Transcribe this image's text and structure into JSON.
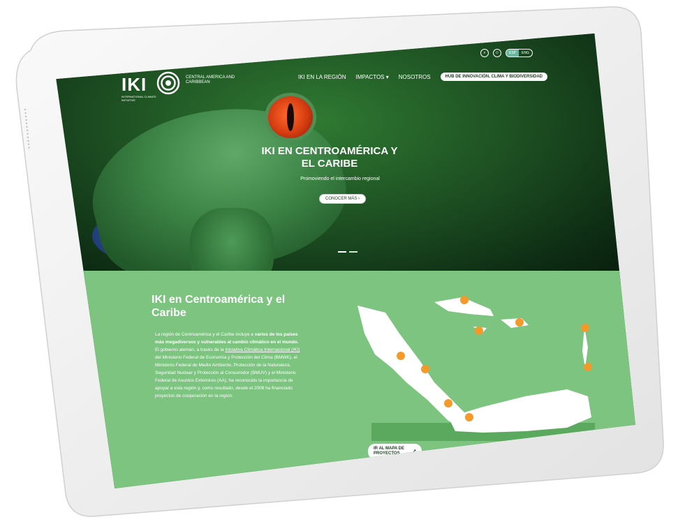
{
  "colors": {
    "accent_green": "#7cc47f",
    "marker_orange": "#f39a2b",
    "lang_active": "#6ab7a0"
  },
  "nav": {
    "logo_text": "IKI",
    "logo_subtitle": "INTERNATIONAL CLIMATE INITIATIVE",
    "logo_region": "CENTRAL AMERICA AND CARIBBEAN",
    "items": [
      {
        "label": "IKI EN LA REGIÓN"
      },
      {
        "label": "IMPACTOS"
      },
      {
        "label": "NOSOTROS"
      }
    ],
    "hub_label": "HUB DE INNOVACIÓN, CLIMA Y BIODIVERSIDAD",
    "lang": {
      "options": [
        "ESP",
        "ENG"
      ],
      "selected": "ESP"
    },
    "icons": [
      "search-icon",
      "accessibility-icon"
    ]
  },
  "hero": {
    "title": "IKI EN CENTROAMÉRICA Y EL CARIBE",
    "subtitle": "Promoviendo el intercambio regional",
    "button_label": "CONOCER MÁS",
    "slides": 2,
    "active_slide": 1
  },
  "section": {
    "title": "IKI en Centroamérica y el Caribe",
    "paragraph_parts": [
      "La región de Centroamérica y el Caribe incluye a ",
      "varios de los países más megadiversos y vulnerables al cambio climático en el mundo.",
      " El gobierno alemán, a través de la ",
      "Iniciativa Climática Internacional (IKI)",
      " del Ministerio Federal de Economía y Protección del Clima (BMWK), el Ministerio Federal de Medio Ambiente, Protección de la Naturaleza, Seguridad Nuclear y Protección al Consumidor (BMUV) y el Ministerio Federal de Asuntos Exteriores (AA), ha reconocido la importancia de apoyar a esta región y, como resultado, desde el 2008 ha financiado proyectos de cooperación en la región."
    ],
    "map_button": "IR AL MAPA DE PROYECTOS"
  }
}
